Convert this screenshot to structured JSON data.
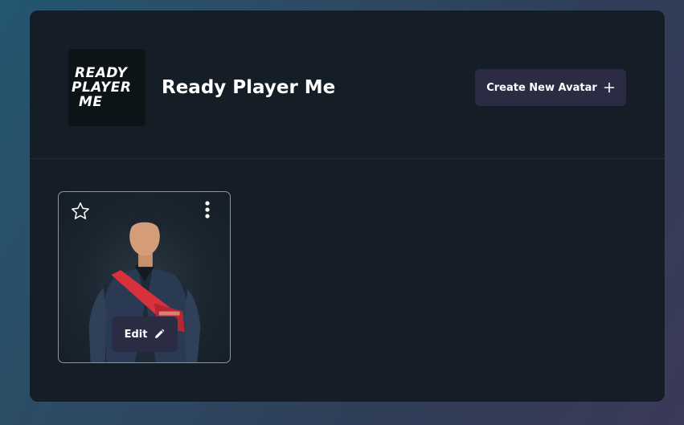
{
  "app": {
    "logo_lines": [
      "READY",
      "PLAYER",
      "ME"
    ],
    "title": "Ready Player Me"
  },
  "header": {
    "create_button_label": "Create New Avatar",
    "create_button_icon": "plus-icon"
  },
  "avatars": [
    {
      "favorite_icon": "star-outline-icon",
      "menu_icon": "more-vertical-icon",
      "edit_label": "Edit",
      "edit_icon": "pencil-icon"
    }
  ],
  "colors": {
    "panel_background": "#151e27",
    "button_background": "#2b2c43",
    "text": "#ffffff",
    "card_border": "#8d949c",
    "bag_red": "#d8313b"
  }
}
